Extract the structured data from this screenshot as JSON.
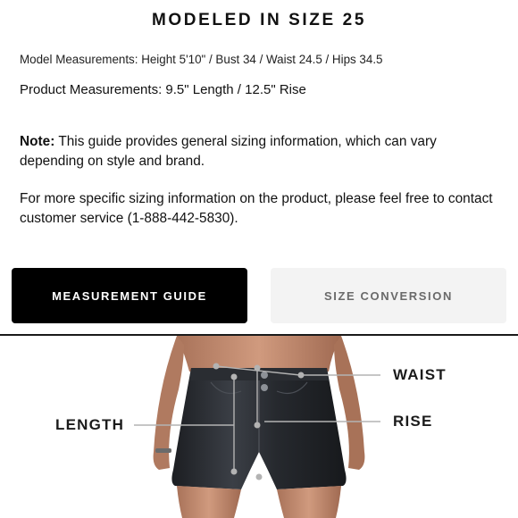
{
  "header": {
    "title": "MODELED IN SIZE 25"
  },
  "measurements": {
    "model": "Model Measurements: Height 5'10\" / Bust 34 / Waist 24.5 / Hips 34.5",
    "product": "Product Measurements: 9.5\" Length / 12.5\" Rise"
  },
  "note": {
    "label": "Note:",
    "text": " This guide provides general sizing information, which can vary depending on style and brand."
  },
  "more_info": "For more specific sizing information on the product, please feel free to contact customer service (1-888-442-5830).",
  "tabs": [
    {
      "label": "MEASUREMENT GUIDE",
      "active": true
    },
    {
      "label": "SIZE CONVERSION",
      "active": false
    }
  ],
  "figure": {
    "labels": {
      "waist": "WAIST",
      "rise": "RISE",
      "length": "LENGTH"
    }
  },
  "colors": {
    "active_tab_bg": "#000000",
    "inactive_tab_bg": "#f3f3f3",
    "inactive_tab_text": "#6a6a6a"
  }
}
